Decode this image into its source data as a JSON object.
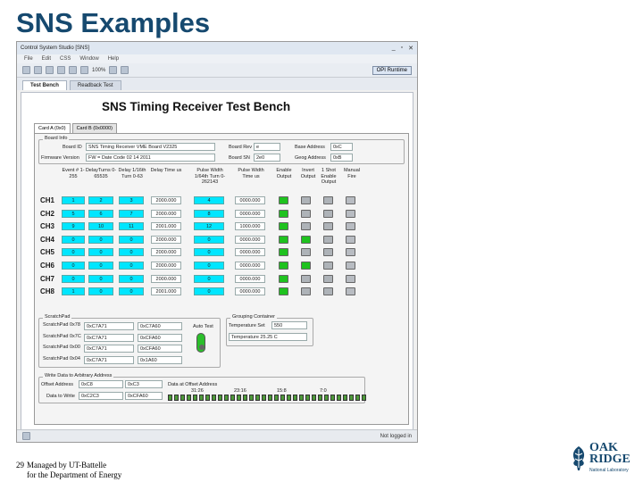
{
  "slide": {
    "title": "SNS Examples",
    "page_number": "29",
    "footer_lines": [
      "Managed by UT-Battelle",
      "for the Department of Energy"
    ],
    "logo_lines": [
      "OAK",
      "RIDGE",
      "National Laboratory"
    ]
  },
  "window": {
    "title": "Control System Studio [SNS]",
    "controls": [
      "_",
      "▫",
      "✕"
    ]
  },
  "menu": [
    "File",
    "Edit",
    "CSS",
    "Window",
    "Help"
  ],
  "toolbar": {
    "zoom": "100%",
    "perspective": "OPI Runtime"
  },
  "editor_tabs": [
    "Test Bench",
    "Readback Test"
  ],
  "bench": {
    "title": "SNS Timing Receiver Test Bench",
    "card_tabs": [
      "Card A (0x0)",
      "Card B (0x0000)"
    ],
    "board_info": {
      "group": "Board Info",
      "board_id_label": "Board ID",
      "board_id": "SNS Timing Receiver VME Board V2325",
      "firmware_label": "Firmware Version",
      "firmware": "FW = Date Code 02 14 2011",
      "board_rev_label": "Board Rev",
      "board_rev": "e",
      "board_sn_label": "Board SN",
      "board_sn": "2e0",
      "base_addr_label": "Base Address",
      "base_addr": "0xC",
      "geog_addr_label": "Geog Address",
      "geog_addr": "0xB"
    },
    "headers": [
      "Event # 1-255",
      "DelayTurns 0-65535",
      "Delay 1/16th Turn 0-63",
      "Delay Time us",
      "Pulse Width 1/64th Turn 0-262143",
      "Pulse Width Time us",
      "Enable Output",
      "Invert Output",
      "1 Shot Enable Output",
      "Manual Fire"
    ],
    "channels": [
      {
        "name": "CH1",
        "event": "1",
        "turns": "2",
        "sixteenth": "3",
        "delay": "2000.000",
        "pw": "4",
        "pwt": "0000.000",
        "enable": true,
        "invert": false
      },
      {
        "name": "CH2",
        "event": "5",
        "turns": "6",
        "sixteenth": "7",
        "delay": "2000.000",
        "pw": "8",
        "pwt": "0000.000",
        "enable": true,
        "invert": false
      },
      {
        "name": "CH3",
        "event": "9",
        "turns": "10",
        "sixteenth": "11",
        "delay": "2001.000",
        "pw": "12",
        "pwt": "1000.000",
        "enable": true,
        "invert": false
      },
      {
        "name": "CH4",
        "event": "0",
        "turns": "0",
        "sixteenth": "0",
        "delay": "2000.000",
        "pw": "0",
        "pwt": "0000.000",
        "enable": true,
        "invert": true
      },
      {
        "name": "CH5",
        "event": "0",
        "turns": "0",
        "sixteenth": "0",
        "delay": "2000.000",
        "pw": "0",
        "pwt": "0000.000",
        "enable": true,
        "invert": false
      },
      {
        "name": "CH6",
        "event": "0",
        "turns": "0",
        "sixteenth": "0",
        "delay": "2000.000",
        "pw": "0",
        "pwt": "0000.000",
        "enable": true,
        "invert": true
      },
      {
        "name": "CH7",
        "event": "0",
        "turns": "0",
        "sixteenth": "0",
        "delay": "2000.000",
        "pw": "0",
        "pwt": "0000.000",
        "enable": true,
        "invert": false
      },
      {
        "name": "CH8",
        "event": "1",
        "turns": "0",
        "sixteenth": "0",
        "delay": "2001.000",
        "pw": "0",
        "pwt": "0000.000",
        "enable": true,
        "invert": false
      }
    ],
    "scratchpad": {
      "group": "ScratchPad",
      "rows": [
        {
          "label": "ScratchPad 0x78",
          "value": "0xC7A71",
          "read": "0xC7A60"
        },
        {
          "label": "ScratchPad 0x7C",
          "value": "0xC7A71",
          "read": "0xCFA60"
        },
        {
          "label": "ScratchPad 0x00",
          "value": "0xC7A71",
          "read": "0xCFA60"
        },
        {
          "label": "ScratchPad 0x04",
          "value": "0xC7A71",
          "read": "0x1A60"
        }
      ],
      "auto_test": "Auto Test"
    },
    "grouping": {
      "group": "Grouping Container",
      "temp_set_label": "Temperature Set",
      "temp_set": "550",
      "temp_label": "Temperature",
      "temp": "25.25 C"
    },
    "write": {
      "group": "Write Data to Arbitrary Address",
      "offset_label": "Offset Address",
      "offset": "0xC8",
      "offset_read": "0xC3",
      "data_label": "Data to Write",
      "data": "0xC2C3",
      "data_read": "0xCFA60",
      "readback_label": "Data at Offset Address",
      "bits": [
        "31:26",
        "23:16",
        "15:8",
        "7:0"
      ]
    }
  },
  "status": {
    "right": "Not logged in"
  }
}
